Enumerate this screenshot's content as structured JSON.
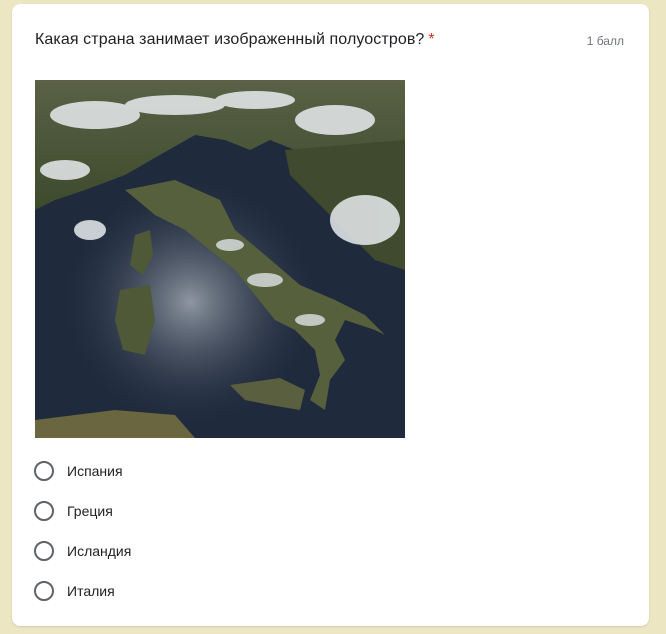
{
  "question": {
    "title": "Какая страна занимает изображенный полуостров?",
    "required_mark": "*",
    "points": "1 балл",
    "image_alt": "satellite-map-italy"
  },
  "options": [
    {
      "label": "Испания",
      "selected": false
    },
    {
      "label": "Греция",
      "selected": false
    },
    {
      "label": "Исландия",
      "selected": false
    },
    {
      "label": "Италия",
      "selected": false
    }
  ],
  "colors": {
    "page_background": "#ece6c3",
    "card_background": "#ffffff",
    "required_star": "#d93025",
    "radio_border": "#5f6368"
  }
}
